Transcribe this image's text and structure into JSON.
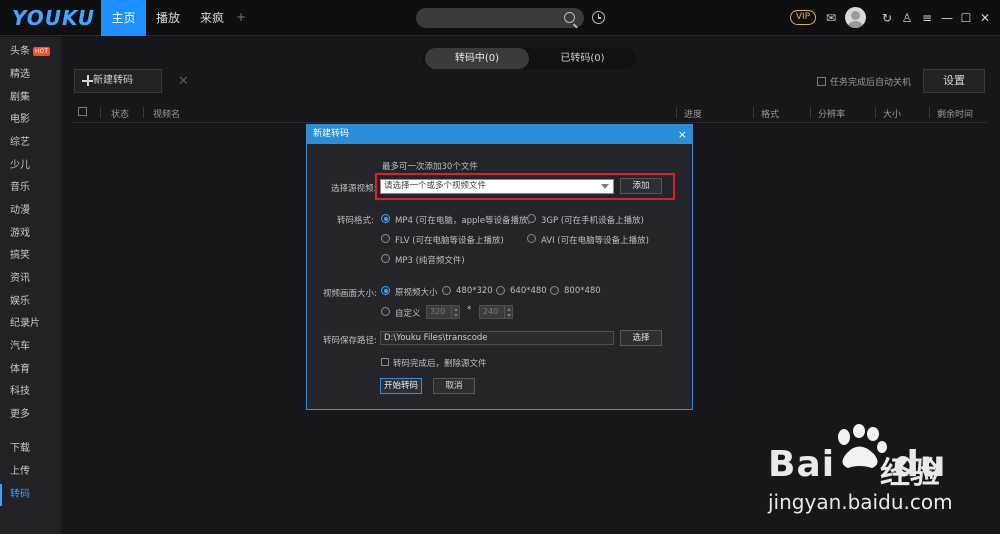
{
  "header": {
    "logo": "YOUKU",
    "tabs": [
      {
        "label": "主页",
        "active": true
      },
      {
        "label": "播放",
        "active": false
      },
      {
        "label": "来疯",
        "active": false
      }
    ],
    "add_tab": "+",
    "vip": "VIP"
  },
  "sidebar": {
    "items": [
      {
        "label": "头条",
        "badge": "HOT"
      },
      {
        "label": "精选"
      },
      {
        "label": "剧集"
      },
      {
        "label": "电影"
      },
      {
        "label": "综艺"
      },
      {
        "label": "少儿"
      },
      {
        "label": "音乐"
      },
      {
        "label": "动漫"
      },
      {
        "label": "游戏"
      },
      {
        "label": "搞笑"
      },
      {
        "label": "资讯"
      },
      {
        "label": "娱乐"
      },
      {
        "label": "纪录片"
      },
      {
        "label": "汽车"
      },
      {
        "label": "体育"
      },
      {
        "label": "科技"
      },
      {
        "label": "更多"
      }
    ],
    "bottom": [
      {
        "label": "下载"
      },
      {
        "label": "上传"
      },
      {
        "label": "转码",
        "active": true
      }
    ]
  },
  "main": {
    "segments": [
      {
        "label": "转码中(0)",
        "active": true
      },
      {
        "label": "已转码(0)",
        "active": false
      }
    ],
    "new_button": "新建转码",
    "clear_icon": "✕",
    "auto_shutdown": "任务完成后自动关机",
    "settings_button": "设置",
    "columns": [
      "状态",
      "视频名",
      "进度",
      "格式",
      "分辨率",
      "大小",
      "剩余时间"
    ]
  },
  "dialog": {
    "title": "新建转码",
    "close": "×",
    "hint": "最多可一次添加30个文件",
    "source_label": "选择源视频:",
    "source_placeholder": "请选择一个或多个视频文件",
    "add_button": "添加",
    "format_label": "转码格式:",
    "formats": {
      "mp4": "MP4 (可在电脑，apple等设备播放)",
      "gp3": "3GP (可在手机设备上播放)",
      "flv": "FLV (可在电脑等设备上播放)",
      "avi": "AVI (可在电脑等设备上播放)",
      "mp3": "MP3 (纯音频文件)"
    },
    "size_label": "视频画面大小:",
    "sizes": {
      "original": "原视频大小",
      "s480": "480*320",
      "s640": "640*480",
      "s800": "800*480",
      "custom": "自定义"
    },
    "custom_width": "320",
    "times": "*",
    "custom_height": "240",
    "path_label": "转码保存路径:",
    "path_value": "D:\\Youku Files\\transcode",
    "choose_button": "选择",
    "delete_source": "转码完成后，删除源文件",
    "start_button": "开始转码",
    "cancel_button": "取消"
  },
  "watermark": {
    "brand": "Bai",
    "brand2": "du",
    "cn": "经验",
    "url": "jingyan.baidu.com"
  }
}
